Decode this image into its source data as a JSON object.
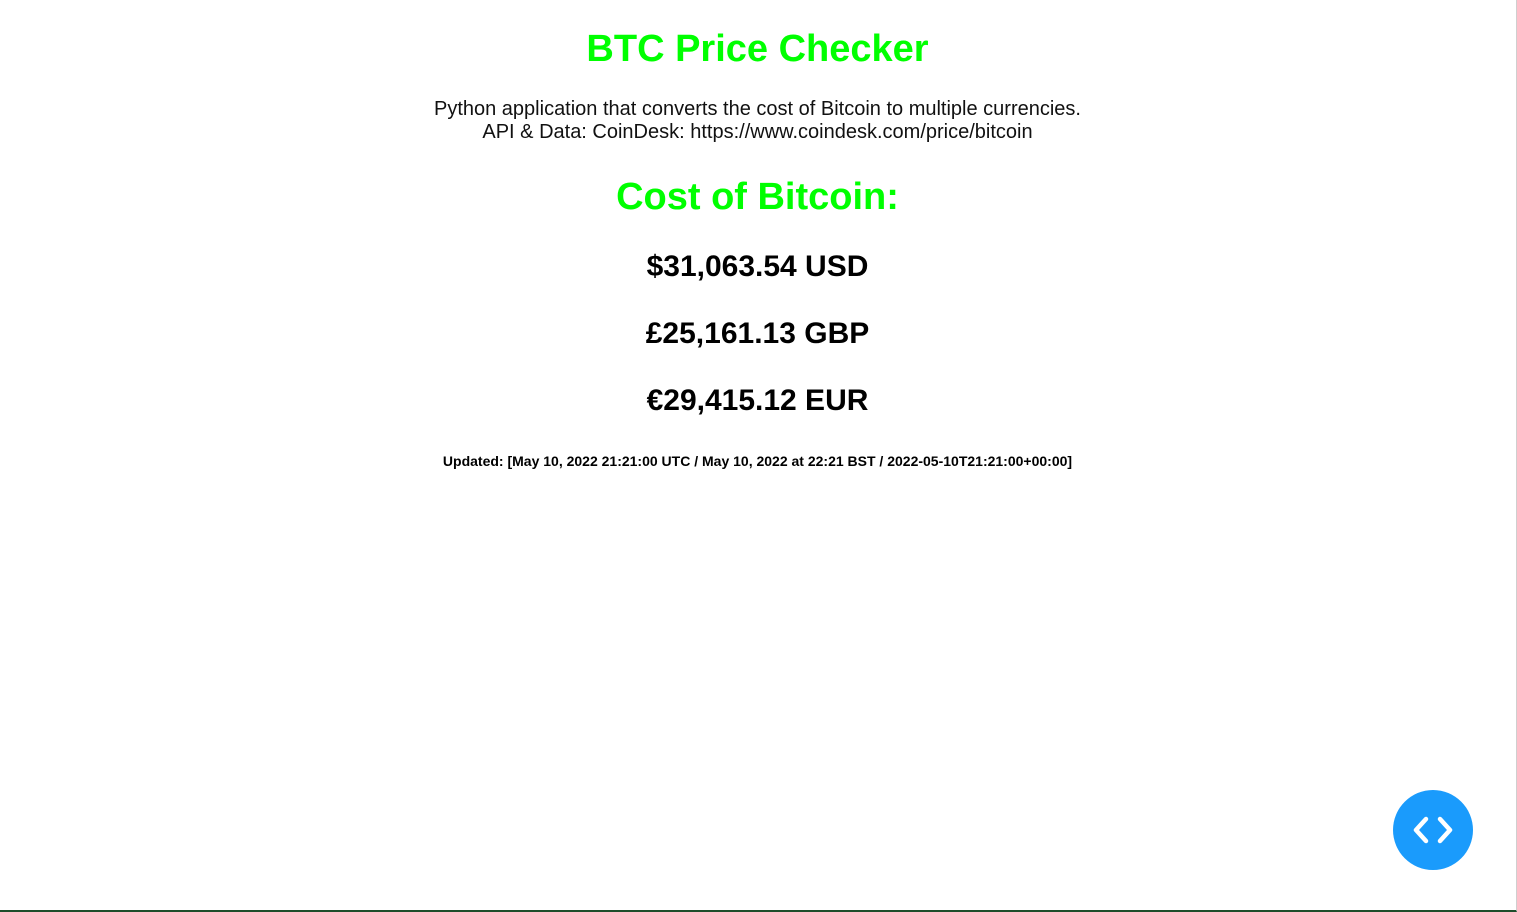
{
  "header": {
    "title": "BTC Price Checker",
    "description_line1": "Python application that converts the cost of Bitcoin to multiple currencies.",
    "description_line2": "API & Data: CoinDesk: https://www.coindesk.com/price/bitcoin"
  },
  "main": {
    "subtitle": "Cost of Bitcoin:",
    "prices": {
      "usd": "$31,063.54 USD",
      "gbp": "£25,161.13 GBP",
      "eur": "€29,415.12 EUR"
    },
    "updated": "Updated: [May 10, 2022 21:21:00 UTC / May 10, 2022 at 22:21 BST / 2022-05-10T21:21:00+00:00]"
  },
  "fab": {
    "icon": "code-icon"
  },
  "colors": {
    "accent_green": "#00ff00",
    "fab_blue": "#1a9bfc",
    "text": "#000000"
  }
}
